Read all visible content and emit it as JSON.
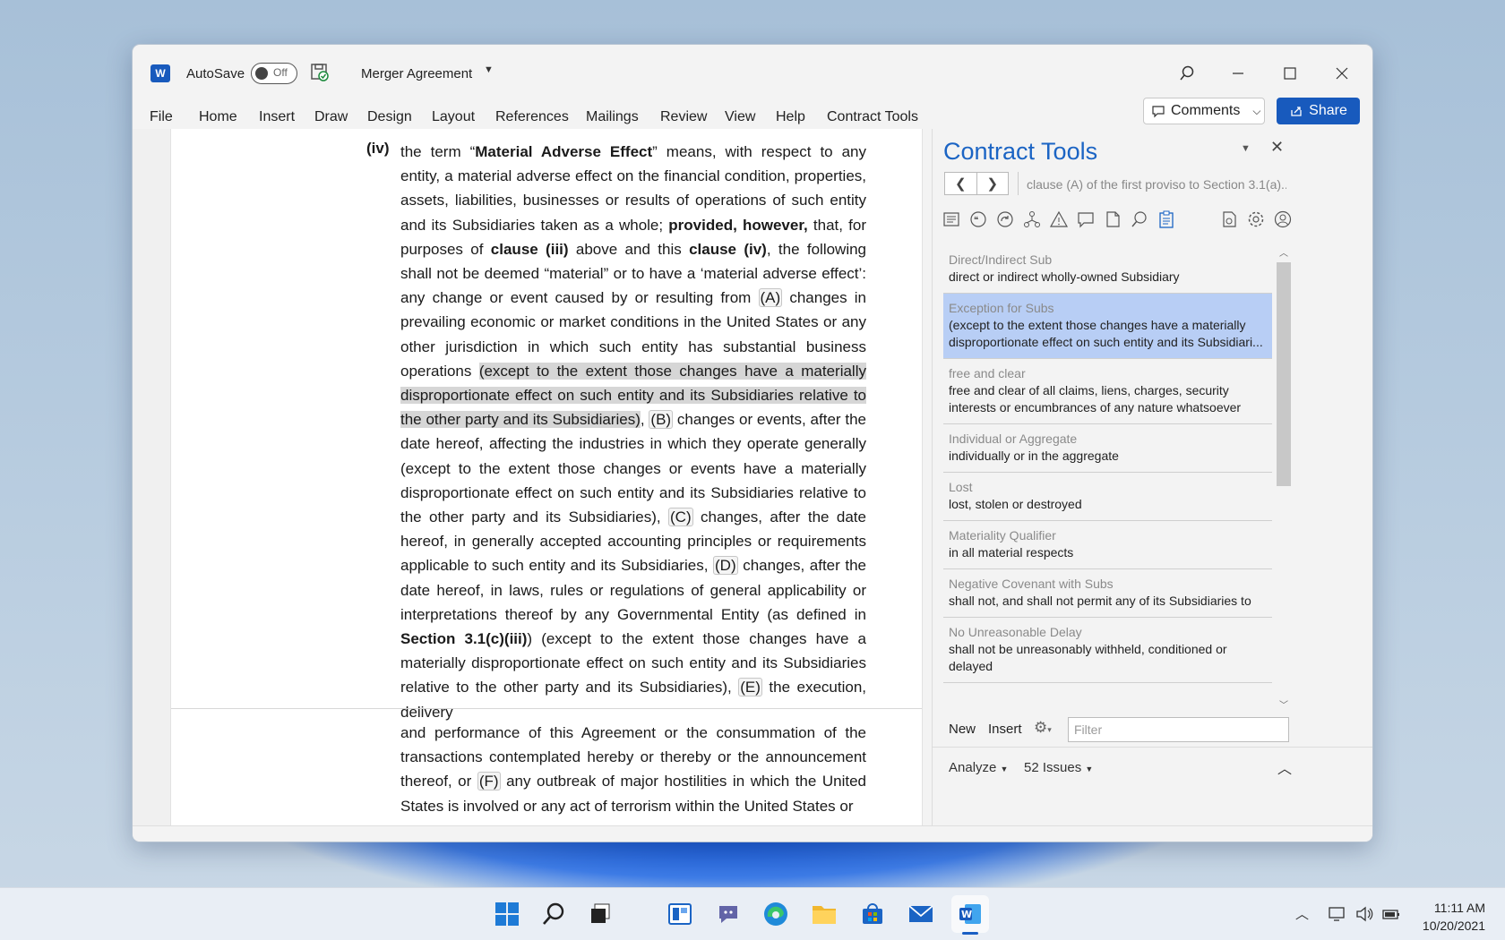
{
  "app": {
    "autosave_label": "AutoSave",
    "autosave_state": "Off",
    "document_title": "Merger Agreement"
  },
  "ribbon_tabs": [
    "File",
    "Home",
    "Insert",
    "Draw",
    "Design",
    "Layout",
    "References",
    "Mailings",
    "Review",
    "View",
    "Help",
    "Contract Tools"
  ],
  "ribbon_buttons": {
    "comments": "Comments",
    "share": "Share"
  },
  "document": {
    "item_number": "(iv)",
    "paragraph_1": "the term “Material Adverse Effect” means, with respect to any entity, a material adverse effect on the financial condition, properties, assets, liabilities, businesses or results of operations of such entity and its Subsidiaries taken as a whole; provided, however, that, for purposes of clause (iii) above and this clause (iv), the following shall not be deemed “material” or to have a ‘material adverse effect’: any change or event caused by or resulting from (A) changes in prevailing economic or market conditions in the United States or any other jurisdiction in which such entity has substantial business operations (except to the extent those changes have a materially disproportionate effect on such entity and its Subsidiaries relative to the other party and its Subsidiaries), (B) changes or events, after the date hereof, affecting the industries in which they operate generally (except to the extent those changes or events have a materially disproportionate effect on such entity and its Subsidiaries relative to the other party and its Subsidiaries), (C) changes, after the date hereof, in generally accepted accounting principles or requirements applicable to such entity and its Subsidiaries, (D) changes, after the date hereof, in laws, rules or regulations of general applicability or interpretations thereof by any Governmental Entity (as defined in Section 3.1(c)(iii)) (except to the extent those changes have a materially disproportionate effect on such entity and its Subsidiaries relative to the other party and its Subsidiaries), (E) the execution, delivery",
    "paragraph_2": "and performance of this Agreement or the consummation of the transactions contemplated hereby or thereby or the announcement thereof, or (F) any outbreak of major hostilities in which the United States is involved or any act of terrorism within the United States or"
  },
  "pane": {
    "title": "Contract Tools",
    "breadcrumb": "clause (A) of the first proviso to Section 3.1(a)...",
    "toolbar_icons": [
      "outline-icon",
      "quote-icon",
      "redo-circle-icon",
      "hierarchy-icon",
      "warning-icon",
      "comment-icon",
      "page-icon",
      "search-icon",
      "clipboard-icon",
      "document-settings-icon",
      "gear-icon",
      "user-icon"
    ],
    "clauses": [
      {
        "title": "Direct/Indirect Sub",
        "text": "direct or indirect wholly-owned Subsidiary",
        "selected": false
      },
      {
        "title": "Exception for Subs",
        "text": "(except to the extent those changes have a materially disproportionate effect on such entity and its Subsidiari...",
        "selected": true
      },
      {
        "title": "free and clear",
        "text": "free and clear of all claims, liens, charges, security interests or encumbrances of any nature whatsoever",
        "selected": false
      },
      {
        "title": "Individual or Aggregate",
        "text": "individually or in the aggregate",
        "selected": false
      },
      {
        "title": "Lost",
        "text": "lost, stolen or destroyed",
        "selected": false
      },
      {
        "title": "Materiality Qualifier",
        "text": "in all material respects",
        "selected": false
      },
      {
        "title": "Negative Covenant with Subs",
        "text": "shall not, and shall not permit any of its Subsidiaries to",
        "selected": false
      },
      {
        "title": "No Unreasonable Delay",
        "text": "shall not be unreasonably withheld, conditioned or delayed",
        "selected": false
      }
    ],
    "bottom": {
      "new": "New",
      "insert": "Insert",
      "filter_placeholder": "Filter"
    },
    "status": {
      "analyze": "Analyze",
      "issues": "52 Issues"
    }
  },
  "taskbar": {
    "apps": [
      "windows-start-icon",
      "search-icon",
      "task-view-icon",
      "widgets-icon",
      "teams-chat-icon",
      "edge-icon",
      "file-explorer-icon",
      "store-icon",
      "mail-icon",
      "word-icon"
    ],
    "time": "11:11 AM",
    "date": "10/20/2021"
  },
  "colors": {
    "accent": "#185abd",
    "pane_title": "#1b64c4",
    "selection": "#b8cef5"
  }
}
